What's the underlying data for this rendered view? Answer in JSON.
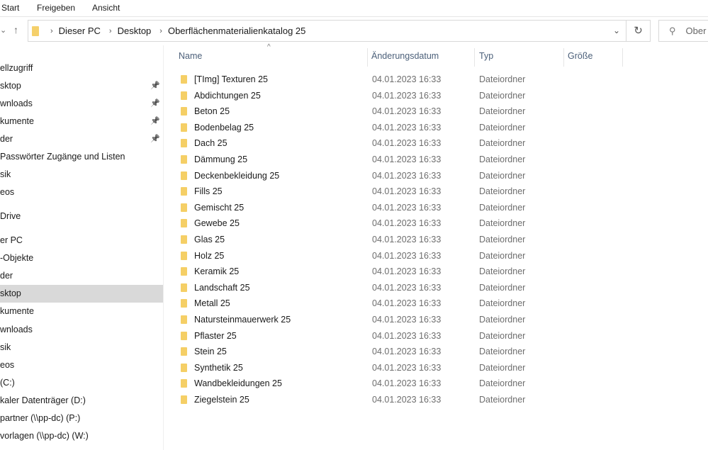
{
  "ribbon": {
    "tabs": [
      "Start",
      "Freigeben",
      "Ansicht"
    ]
  },
  "address": {
    "crumbs": [
      "Dieser PC",
      "Desktop",
      "Oberflächenmaterialienkatalog 25"
    ]
  },
  "search": {
    "placeholder": "Ober"
  },
  "sidebar": {
    "items": [
      {
        "label": "ellzugriff"
      },
      {
        "label": "sktop",
        "pinned": true
      },
      {
        "label": "wnloads",
        "pinned": true
      },
      {
        "label": "kumente",
        "pinned": true
      },
      {
        "label": "der",
        "pinned": true
      },
      {
        "label": "Passwörter Zugänge und Listen"
      },
      {
        "label": "sik"
      },
      {
        "label": "eos"
      },
      {
        "label": "Drive"
      },
      {
        "label": "er PC"
      },
      {
        "label": "-Objekte"
      },
      {
        "label": "der"
      },
      {
        "label": "sktop",
        "selected": true
      },
      {
        "label": "kumente"
      },
      {
        "label": "wnloads"
      },
      {
        "label": "sik"
      },
      {
        "label": "eos"
      },
      {
        "label": "(C:)"
      },
      {
        "label": "kaler Datenträger (D:)"
      },
      {
        "label": "partner (\\\\pp-dc) (P:)"
      },
      {
        "label": "vorlagen (\\\\pp-dc) (W:)"
      }
    ]
  },
  "columns": {
    "name": "Name",
    "date": "Änderungsdatum",
    "type": "Typ",
    "size": "Größe"
  },
  "files": [
    {
      "name": "[TImg] Texturen 25",
      "date": "04.01.2023 16:33",
      "type": "Dateiordner"
    },
    {
      "name": "Abdichtungen 25",
      "date": "04.01.2023 16:33",
      "type": "Dateiordner"
    },
    {
      "name": "Beton 25",
      "date": "04.01.2023 16:33",
      "type": "Dateiordner"
    },
    {
      "name": "Bodenbelag 25",
      "date": "04.01.2023 16:33",
      "type": "Dateiordner"
    },
    {
      "name": "Dach 25",
      "date": "04.01.2023 16:33",
      "type": "Dateiordner"
    },
    {
      "name": "Dämmung 25",
      "date": "04.01.2023 16:33",
      "type": "Dateiordner"
    },
    {
      "name": "Deckenbekleidung 25",
      "date": "04.01.2023 16:33",
      "type": "Dateiordner"
    },
    {
      "name": "Fills 25",
      "date": "04.01.2023 16:33",
      "type": "Dateiordner"
    },
    {
      "name": "Gemischt 25",
      "date": "04.01.2023 16:33",
      "type": "Dateiordner"
    },
    {
      "name": "Gewebe 25",
      "date": "04.01.2023 16:33",
      "type": "Dateiordner"
    },
    {
      "name": "Glas 25",
      "date": "04.01.2023 16:33",
      "type": "Dateiordner"
    },
    {
      "name": "Holz 25",
      "date": "04.01.2023 16:33",
      "type": "Dateiordner"
    },
    {
      "name": "Keramik 25",
      "date": "04.01.2023 16:33",
      "type": "Dateiordner"
    },
    {
      "name": "Landschaft 25",
      "date": "04.01.2023 16:33",
      "type": "Dateiordner"
    },
    {
      "name": "Metall 25",
      "date": "04.01.2023 16:33",
      "type": "Dateiordner"
    },
    {
      "name": "Natursteinmauerwerk 25",
      "date": "04.01.2023 16:33",
      "type": "Dateiordner"
    },
    {
      "name": "Pflaster 25",
      "date": "04.01.2023 16:33",
      "type": "Dateiordner"
    },
    {
      "name": "Stein 25",
      "date": "04.01.2023 16:33",
      "type": "Dateiordner"
    },
    {
      "name": "Synthetik 25",
      "date": "04.01.2023 16:33",
      "type": "Dateiordner"
    },
    {
      "name": "Wandbekleidungen 25",
      "date": "04.01.2023 16:33",
      "type": "Dateiordner"
    },
    {
      "name": "Ziegelstein 25",
      "date": "04.01.2023 16:33",
      "type": "Dateiordner"
    }
  ]
}
